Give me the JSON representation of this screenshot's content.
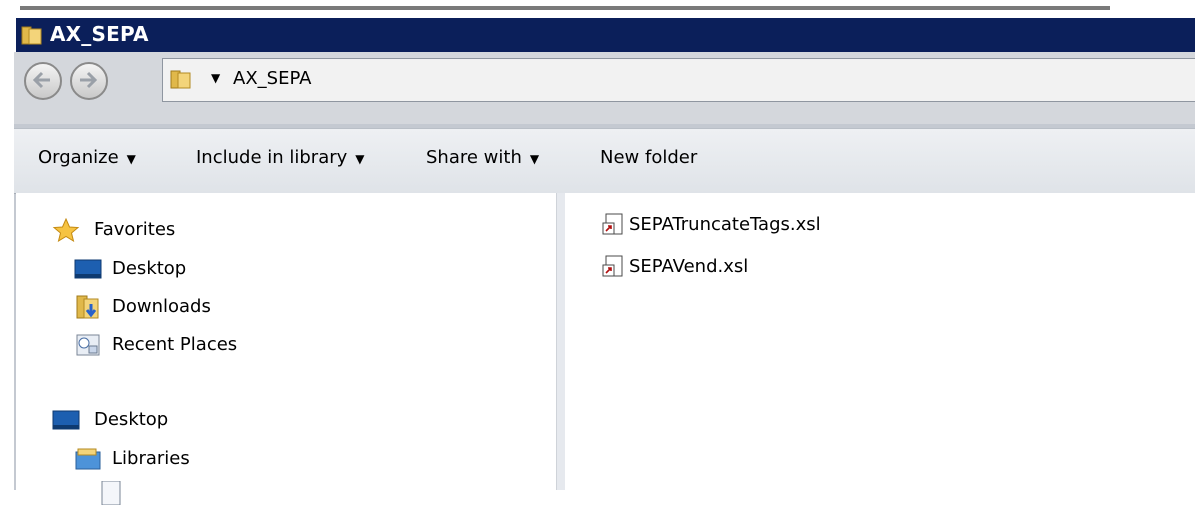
{
  "window": {
    "title": "AX_SEPA"
  },
  "address_bar": {
    "path": "AX_SEPA"
  },
  "toolbar": {
    "organize": "Organize",
    "include_in_library": "Include in library",
    "share_with": "Share with",
    "new_folder": "New folder"
  },
  "nav_pane": {
    "favorites": "Favorites",
    "favorites_items": [
      "Desktop",
      "Downloads",
      "Recent Places"
    ],
    "desktop": "Desktop",
    "libraries": "Libraries"
  },
  "files": [
    {
      "name": "SEPATruncateTags.xsl",
      "icon": "xsl-shortcut-icon"
    },
    {
      "name": "SEPAVend.xsl",
      "icon": "xsl-shortcut-icon"
    }
  ],
  "colors": {
    "titlebar": "#0b1f5a",
    "toolbar": "#e6e9ee"
  }
}
